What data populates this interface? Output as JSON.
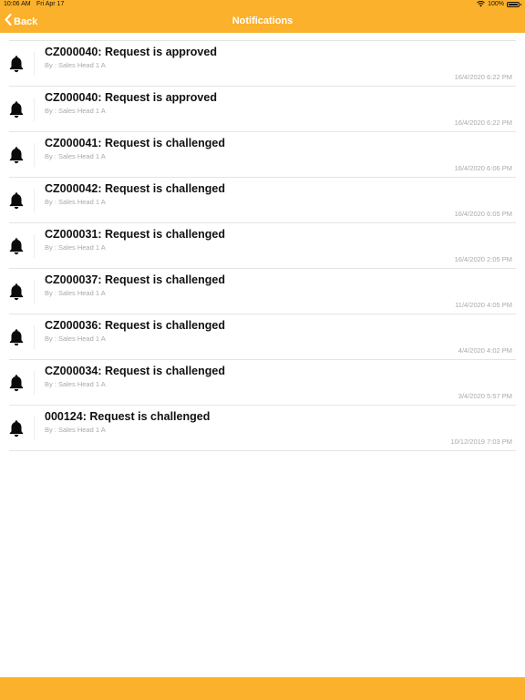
{
  "status_bar": {
    "time": "10:06 AM",
    "date": "Fri Apr 17",
    "battery": "100%",
    "battery_level": 1.0,
    "icons": [
      "wifi-icon",
      "battery-icon"
    ]
  },
  "header": {
    "back_label": "Back",
    "title": "Notifications",
    "color": "#fbb12b"
  },
  "notifications": [
    {
      "title": "CZ000040: Request is approved",
      "by": "By : Sales Head 1 A",
      "time": "16/4/2020 6:22 PM"
    },
    {
      "title": "CZ000040: Request is approved",
      "by": "By : Sales Head 1 A",
      "time": "16/4/2020 6:22 PM"
    },
    {
      "title": "CZ000041: Request is challenged",
      "by": "By : Sales Head 1 A",
      "time": "16/4/2020 6:06 PM"
    },
    {
      "title": "CZ000042: Request is challenged",
      "by": "By : Sales Head 1 A",
      "time": "16/4/2020 6:05 PM"
    },
    {
      "title": "CZ000031: Request is challenged",
      "by": "By : Sales Head 1 A",
      "time": "16/4/2020 2:05 PM"
    },
    {
      "title": "CZ000037: Request is challenged",
      "by": "By : Sales Head 1 A",
      "time": "11/4/2020 4:05 PM"
    },
    {
      "title": "CZ000036: Request is challenged",
      "by": "By : Sales Head 1 A",
      "time": "4/4/2020 4:02 PM"
    },
    {
      "title": "CZ000034: Request is challenged",
      "by": "By : Sales Head 1 A",
      "time": "3/4/2020 5:57 PM"
    },
    {
      "title": "000124: Request is challenged",
      "by": "By : Sales Head 1 A",
      "time": "10/12/2019 7:03 PM"
    }
  ]
}
